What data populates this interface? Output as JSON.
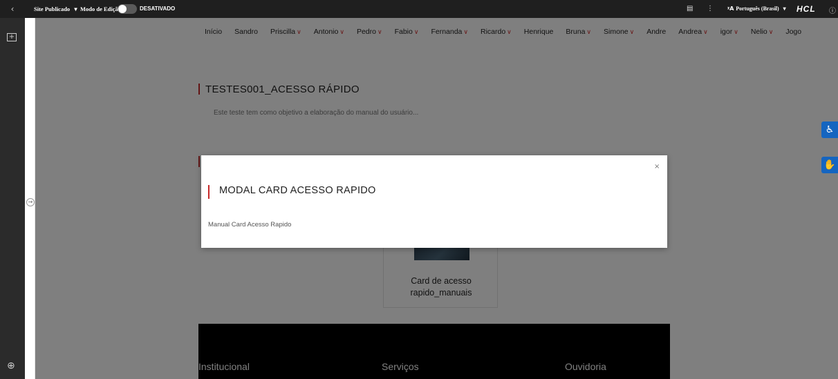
{
  "topbar": {
    "back_icon": "chevron-left",
    "publish_label": "Site Publicado",
    "publish_caret": "▾",
    "edit_mode_label": "Modo de Edição:",
    "edit_mode_state": "DESATIVADO",
    "language": "Português (Brasil)",
    "language_caret": "▾",
    "brand": "HCL"
  },
  "nav": {
    "items": [
      {
        "label": "Início",
        "has_dropdown": false
      },
      {
        "label": "Sandro",
        "has_dropdown": false
      },
      {
        "label": "Priscilla",
        "has_dropdown": true
      },
      {
        "label": "Antonio",
        "has_dropdown": true
      },
      {
        "label": "Pedro",
        "has_dropdown": true
      },
      {
        "label": "Fabio",
        "has_dropdown": true
      },
      {
        "label": "Fernanda",
        "has_dropdown": true
      },
      {
        "label": "Ricardo",
        "has_dropdown": true
      },
      {
        "label": "Henrique",
        "has_dropdown": false
      },
      {
        "label": "Bruna",
        "has_dropdown": true
      },
      {
        "label": "Simone",
        "has_dropdown": true
      },
      {
        "label": "Andre",
        "has_dropdown": false
      },
      {
        "label": "Andrea",
        "has_dropdown": true
      },
      {
        "label": "igor",
        "has_dropdown": true
      },
      {
        "label": "Nelio",
        "has_dropdown": true
      },
      {
        "label": "Jogo",
        "has_dropdown": false
      }
    ]
  },
  "section": {
    "title": "TESTES001_ACESSO RÁPIDO",
    "description": "Este teste tem como objetivo a elaboração do manual do usuário..."
  },
  "card": {
    "line1": "Card de acesso",
    "line2": "rapido_manuais"
  },
  "footer": {
    "col1": "Institucional",
    "col2": "Serviços",
    "col3": "Ouvidoria"
  },
  "modal": {
    "close": "×",
    "title": "MODAL CARD ACESSO RAPIDO",
    "text": "Manual Card Acesso Rapido"
  },
  "colors": {
    "accent": "#c62828",
    "topbar": "#1f1f1f",
    "sidebar": "#2b2b2b",
    "side_button": "#1565c0"
  }
}
